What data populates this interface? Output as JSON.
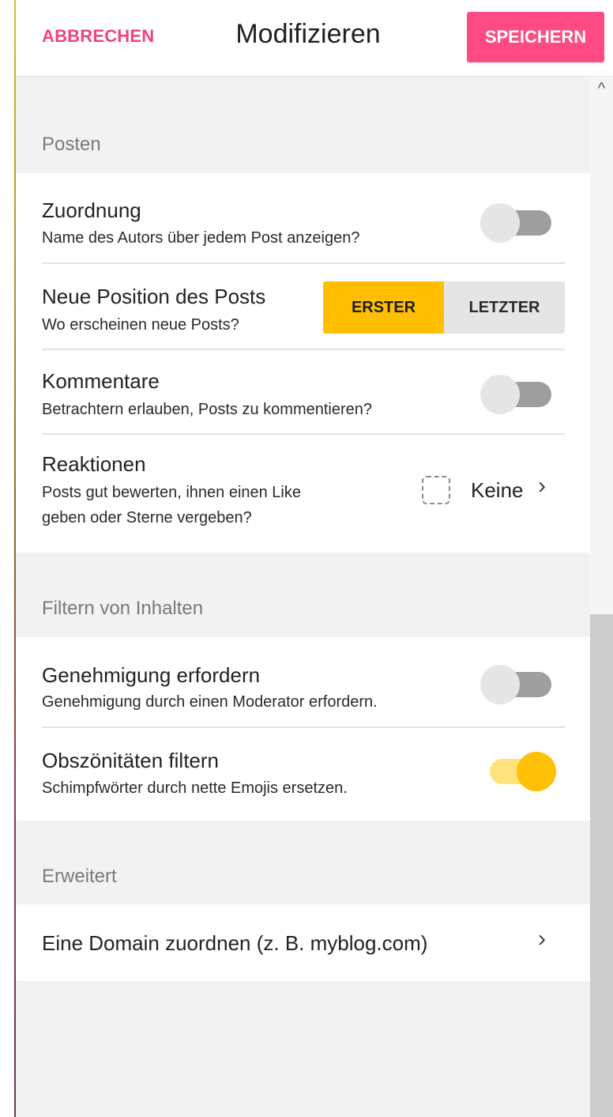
{
  "header": {
    "cancel_label": "ABBRECHEN",
    "title": "Modifizieren",
    "save_label": "SPEICHERN"
  },
  "colors": {
    "accent_pink": "#ff4a84",
    "accent_yellow": "#ffc107"
  },
  "sections": {
    "posten": {
      "title": "Posten",
      "zuordnung": {
        "label": "Zuordnung",
        "description": "Name des Autors über jedem Post anzeigen?",
        "enabled": false
      },
      "position": {
        "label": "Neue Position des Posts",
        "description": "Wo erscheinen neue Posts?",
        "options": [
          "ERSTER",
          "LETZTER"
        ],
        "selected": "ERSTER"
      },
      "kommentare": {
        "label": "Kommentare",
        "description": "Betrachtern erlauben, Posts zu kommentieren?",
        "enabled": false
      },
      "reaktionen": {
        "label": "Reaktionen",
        "description_line1": "Posts gut bewerten, ihnen einen Like",
        "description_line2": "geben oder Sterne vergeben?",
        "value": "Keine"
      }
    },
    "filtern": {
      "title": "Filtern von Inhalten",
      "genehmigung": {
        "label": "Genehmigung erfordern",
        "description": "Genehmigung durch einen Moderator erfordern.",
        "enabled": false
      },
      "obszoenitaeten": {
        "label": "Obszönitäten filtern",
        "description": "Schimpfwörter durch nette Emojis ersetzen.",
        "enabled": true
      }
    },
    "erweitert": {
      "title": "Erweitert",
      "domain": {
        "label": "Eine Domain zuordnen (z. B. myblog.com)"
      }
    }
  },
  "icons": {
    "scroll_up": "^",
    "chevron_right": "›"
  }
}
